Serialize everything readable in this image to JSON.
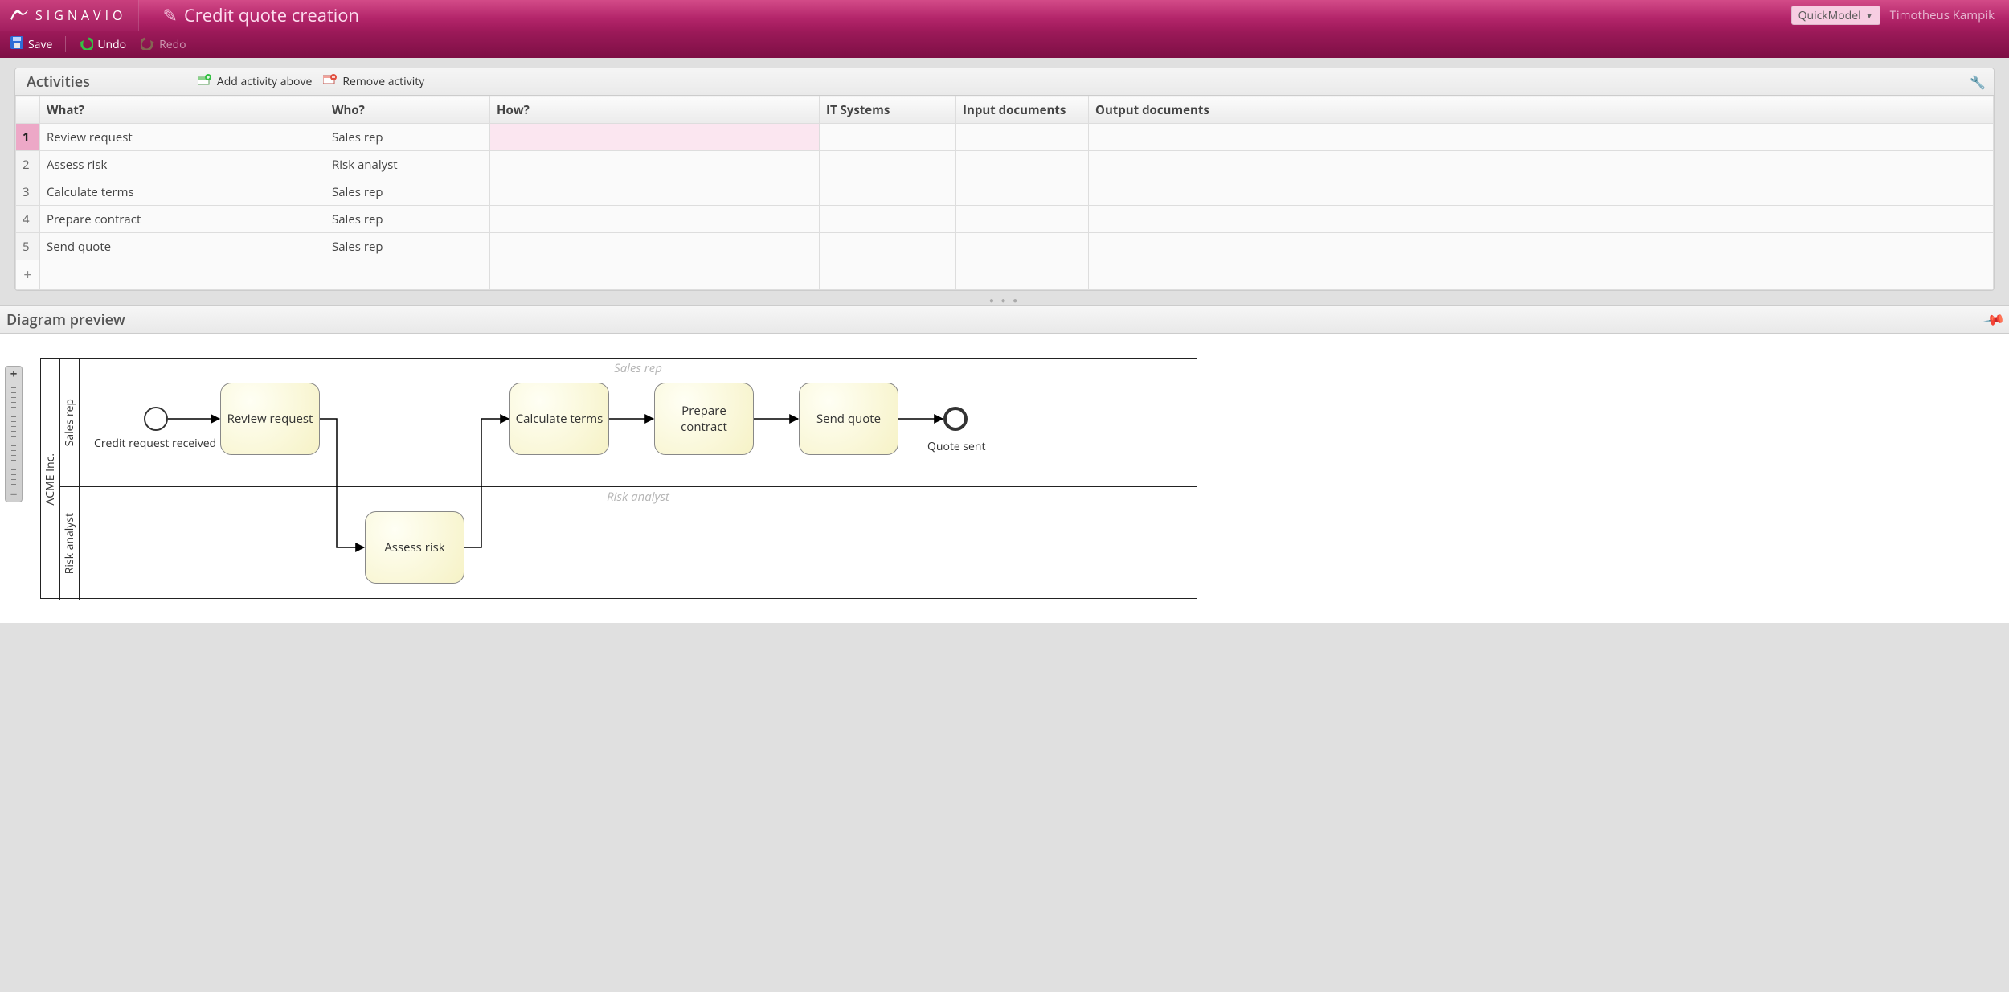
{
  "brand": "SIGNAVIO",
  "page_title": "Credit quote creation",
  "mode_selector": "QuickModel",
  "user": "Timotheus Kampik",
  "toolbar": {
    "save": "Save",
    "undo": "Undo",
    "redo": "Redo"
  },
  "activities_panel": {
    "title": "Activities",
    "add_above": "Add activity above",
    "remove": "Remove activity",
    "columns": {
      "what": "What?",
      "who": "Who?",
      "how": "How?",
      "it_systems": "IT Systems",
      "input_docs": "Input documents",
      "output_docs": "Output documents"
    },
    "rows": [
      {
        "n": "1",
        "what": "Review request",
        "who": "Sales rep",
        "how": "",
        "sys": "",
        "in": "",
        "out": ""
      },
      {
        "n": "2",
        "what": "Assess risk",
        "who": "Risk analyst",
        "how": "",
        "sys": "",
        "in": "",
        "out": ""
      },
      {
        "n": "3",
        "what": "Calculate terms",
        "who": "Sales rep",
        "how": "",
        "sys": "",
        "in": "",
        "out": ""
      },
      {
        "n": "4",
        "what": "Prepare contract",
        "who": "Sales rep",
        "how": "",
        "sys": "",
        "in": "",
        "out": ""
      },
      {
        "n": "5",
        "what": "Send quote",
        "who": "Sales rep",
        "how": "",
        "sys": "",
        "in": "",
        "out": ""
      }
    ],
    "add_row_symbol": "+"
  },
  "preview": {
    "title": "Diagram preview",
    "pool": "ACME Inc.",
    "lanes": {
      "l1": "Sales rep",
      "l2": "Risk analyst"
    },
    "lane_captions": {
      "l1": "Sales rep",
      "l2": "Risk analyst"
    },
    "start_event_label": "Credit request received",
    "end_event_label": "Quote sent",
    "tasks": {
      "t1": "Review request",
      "t2": "Assess risk",
      "t3": "Calculate terms",
      "t4": "Prepare contract",
      "t5": "Send quote"
    }
  }
}
